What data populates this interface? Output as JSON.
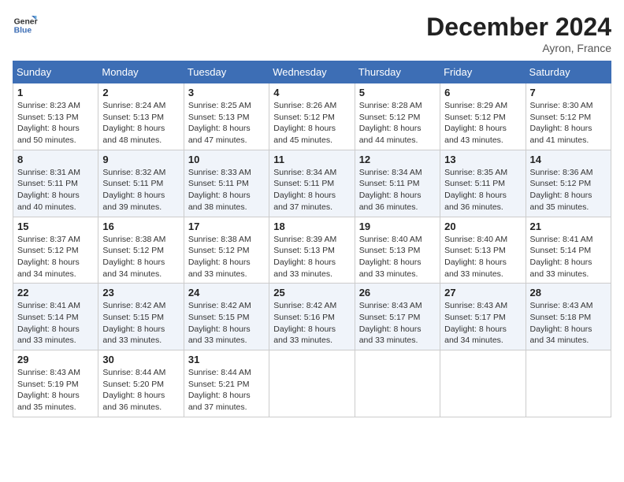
{
  "header": {
    "logo_line1": "General",
    "logo_line2": "Blue",
    "month_title": "December 2024",
    "location": "Ayron, France"
  },
  "days_of_week": [
    "Sunday",
    "Monday",
    "Tuesday",
    "Wednesday",
    "Thursday",
    "Friday",
    "Saturday"
  ],
  "weeks": [
    [
      {
        "day": "1",
        "sunrise": "8:23 AM",
        "sunset": "5:13 PM",
        "daylight": "8 hours and 50 minutes."
      },
      {
        "day": "2",
        "sunrise": "8:24 AM",
        "sunset": "5:13 PM",
        "daylight": "8 hours and 48 minutes."
      },
      {
        "day": "3",
        "sunrise": "8:25 AM",
        "sunset": "5:13 PM",
        "daylight": "8 hours and 47 minutes."
      },
      {
        "day": "4",
        "sunrise": "8:26 AM",
        "sunset": "5:12 PM",
        "daylight": "8 hours and 45 minutes."
      },
      {
        "day": "5",
        "sunrise": "8:28 AM",
        "sunset": "5:12 PM",
        "daylight": "8 hours and 44 minutes."
      },
      {
        "day": "6",
        "sunrise": "8:29 AM",
        "sunset": "5:12 PM",
        "daylight": "8 hours and 43 minutes."
      },
      {
        "day": "7",
        "sunrise": "8:30 AM",
        "sunset": "5:12 PM",
        "daylight": "8 hours and 41 minutes."
      }
    ],
    [
      {
        "day": "8",
        "sunrise": "8:31 AM",
        "sunset": "5:11 PM",
        "daylight": "8 hours and 40 minutes."
      },
      {
        "day": "9",
        "sunrise": "8:32 AM",
        "sunset": "5:11 PM",
        "daylight": "8 hours and 39 minutes."
      },
      {
        "day": "10",
        "sunrise": "8:33 AM",
        "sunset": "5:11 PM",
        "daylight": "8 hours and 38 minutes."
      },
      {
        "day": "11",
        "sunrise": "8:34 AM",
        "sunset": "5:11 PM",
        "daylight": "8 hours and 37 minutes."
      },
      {
        "day": "12",
        "sunrise": "8:34 AM",
        "sunset": "5:11 PM",
        "daylight": "8 hours and 36 minutes."
      },
      {
        "day": "13",
        "sunrise": "8:35 AM",
        "sunset": "5:11 PM",
        "daylight": "8 hours and 36 minutes."
      },
      {
        "day": "14",
        "sunrise": "8:36 AM",
        "sunset": "5:12 PM",
        "daylight": "8 hours and 35 minutes."
      }
    ],
    [
      {
        "day": "15",
        "sunrise": "8:37 AM",
        "sunset": "5:12 PM",
        "daylight": "8 hours and 34 minutes."
      },
      {
        "day": "16",
        "sunrise": "8:38 AM",
        "sunset": "5:12 PM",
        "daylight": "8 hours and 34 minutes."
      },
      {
        "day": "17",
        "sunrise": "8:38 AM",
        "sunset": "5:12 PM",
        "daylight": "8 hours and 33 minutes."
      },
      {
        "day": "18",
        "sunrise": "8:39 AM",
        "sunset": "5:13 PM",
        "daylight": "8 hours and 33 minutes."
      },
      {
        "day": "19",
        "sunrise": "8:40 AM",
        "sunset": "5:13 PM",
        "daylight": "8 hours and 33 minutes."
      },
      {
        "day": "20",
        "sunrise": "8:40 AM",
        "sunset": "5:13 PM",
        "daylight": "8 hours and 33 minutes."
      },
      {
        "day": "21",
        "sunrise": "8:41 AM",
        "sunset": "5:14 PM",
        "daylight": "8 hours and 33 minutes."
      }
    ],
    [
      {
        "day": "22",
        "sunrise": "8:41 AM",
        "sunset": "5:14 PM",
        "daylight": "8 hours and 33 minutes."
      },
      {
        "day": "23",
        "sunrise": "8:42 AM",
        "sunset": "5:15 PM",
        "daylight": "8 hours and 33 minutes."
      },
      {
        "day": "24",
        "sunrise": "8:42 AM",
        "sunset": "5:15 PM",
        "daylight": "8 hours and 33 minutes."
      },
      {
        "day": "25",
        "sunrise": "8:42 AM",
        "sunset": "5:16 PM",
        "daylight": "8 hours and 33 minutes."
      },
      {
        "day": "26",
        "sunrise": "8:43 AM",
        "sunset": "5:17 PM",
        "daylight": "8 hours and 33 minutes."
      },
      {
        "day": "27",
        "sunrise": "8:43 AM",
        "sunset": "5:17 PM",
        "daylight": "8 hours and 34 minutes."
      },
      {
        "day": "28",
        "sunrise": "8:43 AM",
        "sunset": "5:18 PM",
        "daylight": "8 hours and 34 minutes."
      }
    ],
    [
      {
        "day": "29",
        "sunrise": "8:43 AM",
        "sunset": "5:19 PM",
        "daylight": "8 hours and 35 minutes."
      },
      {
        "day": "30",
        "sunrise": "8:44 AM",
        "sunset": "5:20 PM",
        "daylight": "8 hours and 36 minutes."
      },
      {
        "day": "31",
        "sunrise": "8:44 AM",
        "sunset": "5:21 PM",
        "daylight": "8 hours and 37 minutes."
      },
      null,
      null,
      null,
      null
    ]
  ]
}
